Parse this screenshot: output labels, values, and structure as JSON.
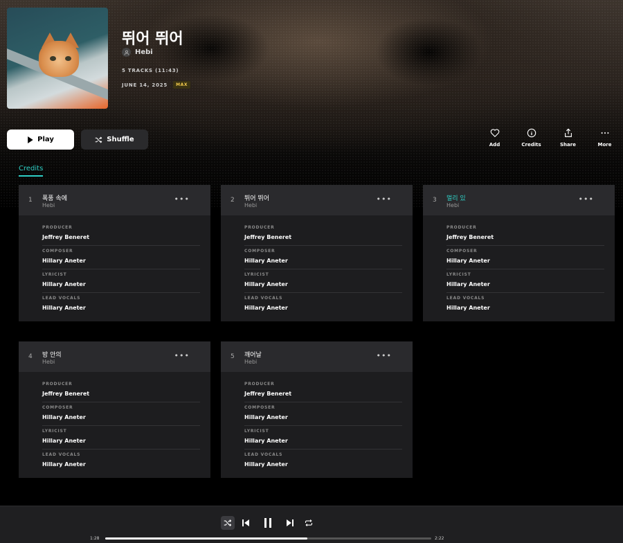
{
  "album": {
    "title": "뛰어 뛰어",
    "artist": "Hebi",
    "tracks_summary": "5 TRACKS  (11:43)",
    "release_date": "JUNE 14, 2025",
    "quality_badge": "MAX"
  },
  "buttons": {
    "play": "Play",
    "shuffle": "Shuffle"
  },
  "actions": [
    {
      "label": "Add",
      "icon": "heart-icon"
    },
    {
      "label": "Credits",
      "icon": "info-icon"
    },
    {
      "label": "Share",
      "icon": "share-icon"
    },
    {
      "label": "More",
      "icon": "more-icon"
    }
  ],
  "tab": "Credits",
  "tracks": [
    {
      "num": "1",
      "title": "폭풍 속에",
      "artist": "Hebi",
      "active": false,
      "credits": [
        {
          "role": "PRODUCER",
          "name": "Jeffrey Beneret"
        },
        {
          "role": "COMPOSER",
          "name": "Hillary Aneter"
        },
        {
          "role": "LYRICIST",
          "name": "Hillary Aneter"
        },
        {
          "role": "LEAD VOCALS",
          "name": "Hillary Aneter"
        }
      ]
    },
    {
      "num": "2",
      "title": "뛰어 뛰어",
      "artist": "Hebi",
      "active": false,
      "credits": [
        {
          "role": "PRODUCER",
          "name": "Jeffrey Beneret"
        },
        {
          "role": "COMPOSER",
          "name": "Hillary Aneter"
        },
        {
          "role": "LYRICIST",
          "name": "Hillary Aneter"
        },
        {
          "role": "LEAD VOCALS",
          "name": "Hillary Aneter"
        }
      ]
    },
    {
      "num": "3",
      "title": "멀리 있",
      "artist": "Hebi",
      "active": true,
      "credits": [
        {
          "role": "PRODUCER",
          "name": "Jeffrey Beneret"
        },
        {
          "role": "COMPOSER",
          "name": "Hillary Aneter"
        },
        {
          "role": "LYRICIST",
          "name": "Hillary Aneter"
        },
        {
          "role": "LEAD VOCALS",
          "name": "Hillary Aneter"
        }
      ]
    },
    {
      "num": "4",
      "title": "방 안의",
      "artist": "Hebi",
      "active": false,
      "credits": [
        {
          "role": "PRODUCER",
          "name": "Jeffrey Beneret"
        },
        {
          "role": "COMPOSER",
          "name": "Hillary Aneter"
        },
        {
          "role": "LYRICIST",
          "name": "Hillary Aneter"
        },
        {
          "role": "LEAD VOCALS",
          "name": "Hillary Aneter"
        }
      ]
    },
    {
      "num": "5",
      "title": "깨어날",
      "artist": "Hebi",
      "active": false,
      "credits": [
        {
          "role": "PRODUCER",
          "name": "Jeffrey Beneret"
        },
        {
          "role": "COMPOSER",
          "name": "Hillary Aneter"
        },
        {
          "role": "LYRICIST",
          "name": "Hillary Aneter"
        },
        {
          "role": "LEAD VOCALS",
          "name": "Hillary Aneter"
        }
      ]
    }
  ],
  "player": {
    "current_time": "1:28",
    "total_time": "2:22",
    "progress_fraction": 0.62
  },
  "colors": {
    "accent": "#2fd0c6",
    "badge_text": "#f2c94c"
  }
}
